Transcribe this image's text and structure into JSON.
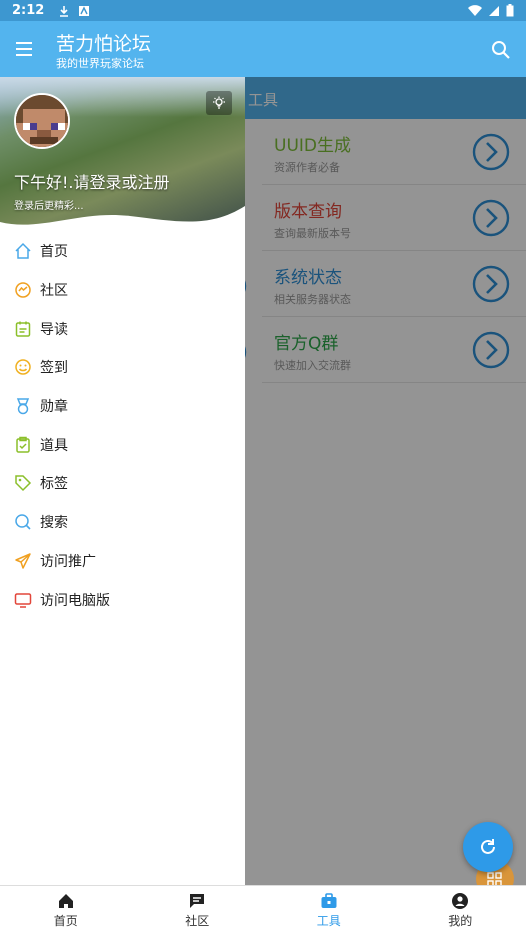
{
  "status_bar": {
    "time": "2:12"
  },
  "app_bar": {
    "title": "苦力怕论坛",
    "subtitle": "我的世界玩家论坛"
  },
  "main": {
    "tab_title": "工具",
    "cards": [
      {
        "title": "UUID生成",
        "subtitle": "资源作者必备",
        "color": "#7fbf3a"
      },
      {
        "title": "版本查询",
        "subtitle": "查询最新版本号",
        "color": "#e2463a"
      },
      {
        "title": "系统状态",
        "subtitle": "相关服务器状态",
        "color": "#2e8fd6"
      },
      {
        "title": "官方Q群",
        "subtitle": "快速加入交流群",
        "color": "#2ea84a"
      }
    ]
  },
  "drawer": {
    "greeting": "下午好!.请登录或注册",
    "greeting_sub": "登录后更精彩...",
    "items": [
      {
        "label": "首页",
        "icon": "home-icon",
        "color": "#4aa8e8"
      },
      {
        "label": "社区",
        "icon": "community-icon",
        "color": "#f0a020"
      },
      {
        "label": "导读",
        "icon": "reading-icon",
        "color": "#8bbf2a"
      },
      {
        "label": "签到",
        "icon": "smile-icon",
        "color": "#f0b020"
      },
      {
        "label": "勋章",
        "icon": "medal-icon",
        "color": "#4aa8e8"
      },
      {
        "label": "道具",
        "icon": "clipboard-icon",
        "color": "#8bbf2a"
      },
      {
        "label": "标签",
        "icon": "tag-icon",
        "color": "#8bbf2a"
      },
      {
        "label": "搜索",
        "icon": "search-icon",
        "color": "#4aa8e8"
      },
      {
        "label": "访问推广",
        "icon": "paper-plane-icon",
        "color": "#f0a020"
      },
      {
        "label": "访问电脑版",
        "icon": "monitor-icon",
        "color": "#e2463a"
      }
    ]
  },
  "bottom_nav": [
    {
      "label": "首页",
      "icon": "home-icon",
      "active": false
    },
    {
      "label": "社区",
      "icon": "chat-icon",
      "active": false
    },
    {
      "label": "工具",
      "icon": "toolbox-icon",
      "active": true
    },
    {
      "label": "我的",
      "icon": "account-icon",
      "active": false
    }
  ],
  "colors": {
    "app_bar": "#53b4ee",
    "status_bar": "#3d97d0",
    "accent": "#2e9ae8"
  }
}
